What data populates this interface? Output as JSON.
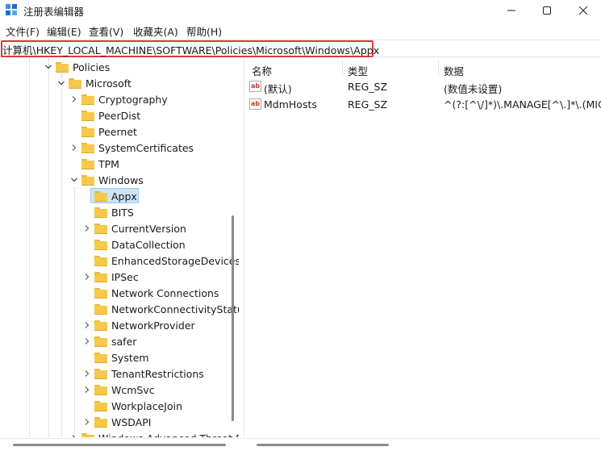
{
  "window": {
    "title": "注册表编辑器",
    "icon": "registry-editor-icon",
    "minimize_icon": "minimize-icon",
    "maximize_icon": "maximize-icon",
    "close_icon": "close-icon"
  },
  "menu": [
    "文件(F)",
    "编辑(E)",
    "查看(V)",
    "收藏夹(A)",
    "帮助(H)"
  ],
  "address": {
    "path": "计算机\\HKEY_LOCAL_MACHINE\\SOFTWARE\\Policies\\Microsoft\\Windows\\Appx",
    "highlight_color": "#e03a3a"
  },
  "tree": {
    "items": [
      {
        "label": "Policies",
        "expanded": true
      },
      {
        "label": "Microsoft",
        "expanded": true
      },
      {
        "label": "Cryptography",
        "expanded": false
      },
      {
        "label": "PeerDist",
        "expanded": null
      },
      {
        "label": "Peernet",
        "expanded": null
      },
      {
        "label": "SystemCertificates",
        "expanded": false
      },
      {
        "label": "TPM",
        "expanded": null
      },
      {
        "label": "Windows",
        "expanded": true
      },
      {
        "label": "Appx",
        "expanded": null,
        "selected": true
      },
      {
        "label": "BITS",
        "expanded": null
      },
      {
        "label": "CurrentVersion",
        "expanded": false
      },
      {
        "label": "DataCollection",
        "expanded": null
      },
      {
        "label": "EnhancedStorageDevices",
        "expanded": null
      },
      {
        "label": "IPSec",
        "expanded": false
      },
      {
        "label": "Network Connections",
        "expanded": null
      },
      {
        "label": "NetworkConnectivityStatusIndicator",
        "expanded": null
      },
      {
        "label": "NetworkProvider",
        "expanded": false
      },
      {
        "label": "safer",
        "expanded": false
      },
      {
        "label": "System",
        "expanded": null
      },
      {
        "label": "TenantRestrictions",
        "expanded": false
      },
      {
        "label": "WcmSvc",
        "expanded": false
      },
      {
        "label": "WorkplaceJoin",
        "expanded": null
      },
      {
        "label": "WSDAPI",
        "expanded": false
      },
      {
        "label": "Windows Advanced Threat Protection",
        "expanded": false
      }
    ],
    "selected_color": "#cce4f7"
  },
  "list": {
    "columns": [
      "名称",
      "类型",
      "数据"
    ],
    "rows": [
      {
        "name": "(默认)",
        "type": "REG_SZ",
        "data": "(数值未设置)",
        "icon": "ab-string-icon"
      },
      {
        "name": "MdmHosts",
        "type": "REG_SZ",
        "data": "^(?:[^\\/]*)\\.MANAGE[^\\.]*\\.(MICR",
        "icon": "ab-string-icon"
      }
    ]
  }
}
